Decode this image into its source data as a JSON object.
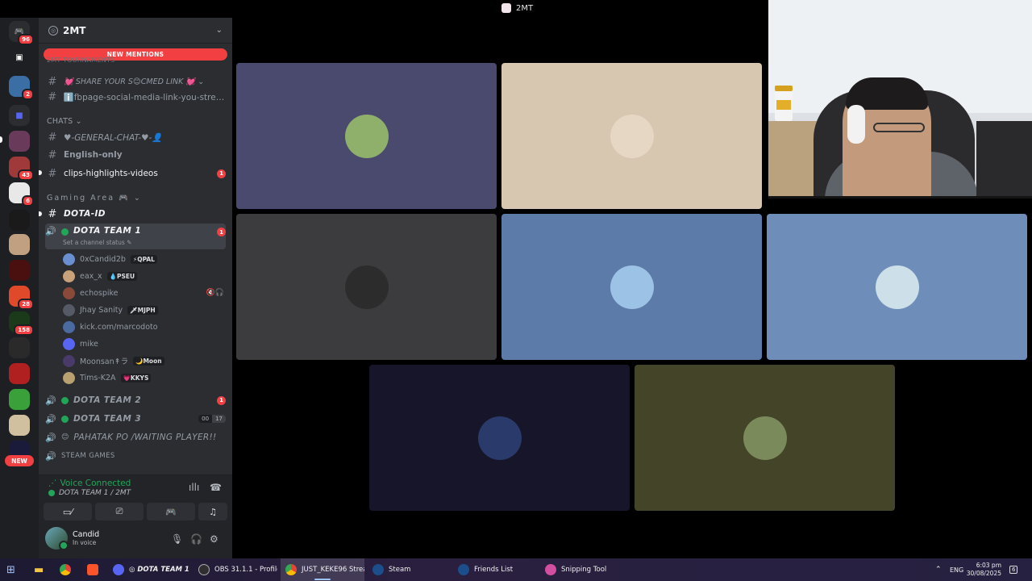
{
  "window_title": "2MT",
  "server": {
    "name": "2MT",
    "new_mentions": "NEW MENTIONS",
    "top_category_partial": "2MT TOURNAMENTS",
    "channels_top": [
      {
        "label": "💓 SHARE YOUR S😊CMED LINK 💓 ⌄"
      },
      {
        "label": "ℹ️fbpage-social-media-link-you-strea..."
      }
    ],
    "chats_category": "CHATS ⌄",
    "chats": [
      {
        "label": "♥-GENERAL-CHAT-♥-👤"
      },
      {
        "label": "English-only"
      },
      {
        "label": "clips-highlights-videos",
        "badge": "1"
      }
    ],
    "gaming_category": "Gaming Area 🎮 ⌄",
    "gaming_text": {
      "label": "DOTA-ID"
    },
    "voice_channels": [
      {
        "label": "DOTA TEAM 1",
        "badge": "1",
        "status": "Set a channel status ✎"
      },
      {
        "label": "DOTA TEAM 2",
        "badge": "1"
      },
      {
        "label": "DOTA TEAM 3",
        "count_a": "00",
        "count_b": "17"
      },
      {
        "label": "PAHATAK PO /WAITING PLAYER!!"
      },
      {
        "label": "STEAM GAMES"
      }
    ],
    "members": [
      {
        "name": "0xCandid2b",
        "tag": "⚡QPAL",
        "color": "#6a8fd0"
      },
      {
        "name": "eax_x",
        "tag": "💧PSEU",
        "color": "#c9a27a"
      },
      {
        "name": "echospike",
        "tag": "",
        "icon": "🔇🎧",
        "color": "#8a4a3a"
      },
      {
        "name": "Jhay Sanity",
        "tag": "🗡MJPH",
        "color": "#555a66"
      },
      {
        "name": "kick.com/marcodoto",
        "tag": "",
        "color": "#4a6aa0"
      },
      {
        "name": "mike",
        "tag": "",
        "color": "#5865f2"
      },
      {
        "name": "Moonsan↟ラ",
        "tag": "🌙Moon",
        "color": "#4a3a6a"
      },
      {
        "name": "Tims-K2A",
        "tag": "💗KKYS",
        "color": "#b8a070"
      }
    ]
  },
  "rail": {
    "dm_badge": "96",
    "badges": [
      "2",
      "43",
      "6",
      "28",
      "158"
    ],
    "new_label": "NEW"
  },
  "voice_panel": {
    "status": "Voice Connected",
    "channel": "DOTA TEAM 1 / 2MT",
    "user_name": "Candid",
    "user_sub": "In voice"
  },
  "stage_tiles": [
    {
      "bg": "#4a4a6e",
      "avatar": "#8fb06a"
    },
    {
      "bg": "#d7c7b1",
      "avatar": "#e6d6c4"
    },
    {
      "bg": "#3c3c3e",
      "avatar": "#2c2c2c"
    },
    {
      "bg": "#5d7ba8",
      "avatar": "#9cc3e6"
    },
    {
      "bg": "#6f8db9",
      "avatar": "#cde0ea"
    },
    {
      "bg": "#17152a",
      "avatar": "#2a3a6a"
    },
    {
      "bg": "#434428",
      "avatar": "#7a8a5a"
    }
  ],
  "taskbar": {
    "items": [
      {
        "label": "◎ DOTA TEAM 1 | ...",
        "color": "#5865f2"
      },
      {
        "label": "OBS 31.1.1 - Profile:...",
        "color": "#302e31"
      },
      {
        "label": "JUST_KEKE96 Strea...",
        "color": "#4285f4"
      },
      {
        "label": "Steam",
        "color": "#1b4e8a"
      },
      {
        "label": "Friends List",
        "color": "#1b4e8a"
      },
      {
        "label": "Snipping Tool",
        "color": "#d14ea0"
      }
    ],
    "lang": "ENG",
    "time": "6:03 pm",
    "date": "30/08/2025",
    "notif": "6"
  }
}
